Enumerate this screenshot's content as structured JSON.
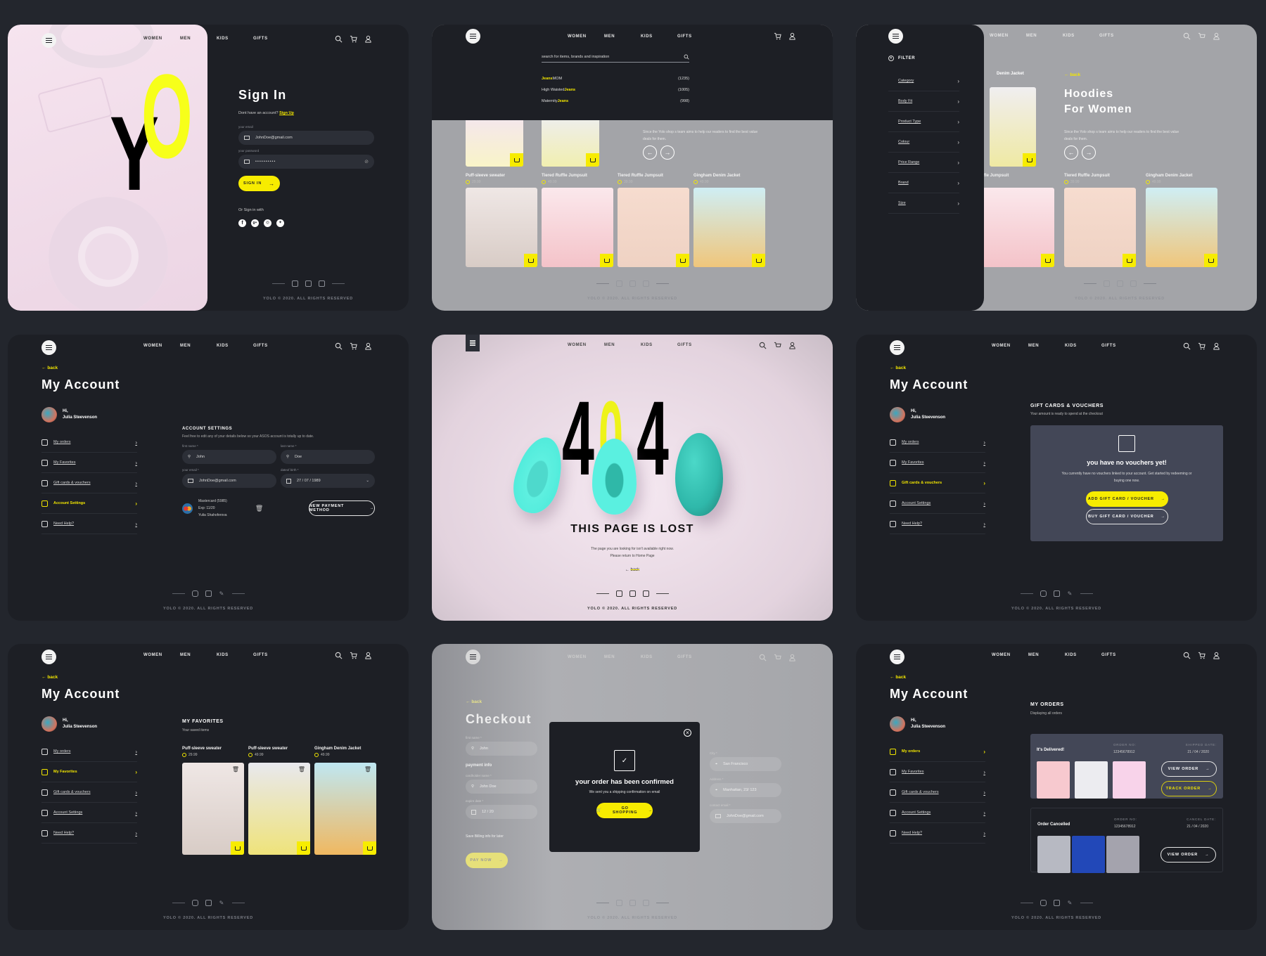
{
  "nav": {
    "links": [
      "WOMEN",
      "MEN",
      "KIDS",
      "GIFTS"
    ],
    "icons": [
      "menu-icon",
      "search-icon",
      "cart-icon",
      "user-icon"
    ]
  },
  "footer": {
    "social_icons": [
      "instagram-icon",
      "facebook-icon",
      "twitter-icon"
    ],
    "copyright": "YOLO © 2020. ALL RIGHTS RESERVED"
  },
  "colors": {
    "accent": "#f7ec00",
    "bg_dark": "#1d1f25",
    "page_bg": "#23262d",
    "card": "#434757",
    "hero_pink": "#f3dce8",
    "teal": "#3fe0d0"
  },
  "signin": {
    "logo_y": "Y",
    "logo_o": "O",
    "title": "Sign In",
    "no_account": "Dont have an account?",
    "signup_link": "Sign Up",
    "email_label": "your email",
    "email_value": "JohnDoe@gmail.com",
    "password_label": "your password",
    "password_value": "••••••••••",
    "button": "SIGN IN",
    "social_label": "Or Sign in with",
    "social": [
      "facebook-icon",
      "google-plus-icon",
      "instagram-icon",
      "twitter-icon"
    ]
  },
  "search": {
    "placeholder": "search for items, brands and inspiration",
    "suggestions": [
      {
        "prefix": "",
        "highlight": "Jeans",
        "suffix": " MOM",
        "count": "(1235)"
      },
      {
        "prefix": "High Waisted ",
        "highlight": "Jeans",
        "suffix": "",
        "count": "(1005)"
      },
      {
        "prefix": "Maternity ",
        "highlight": "Jeans",
        "suffix": "",
        "count": "(998)"
      }
    ],
    "promo_text": "Since the Yolo shop s team aims to help our readers to find the best value deals for them.",
    "products": [
      {
        "name": "Puff-sleeve sweater",
        "price": "29.99"
      },
      {
        "name": "Tiered Ruffle Jumpsuit",
        "price": "49.99"
      },
      {
        "name": "Tiered Ruffle Jumpsuit",
        "price": "39.99"
      },
      {
        "name": "Gingham Denim Jacket",
        "price": "49.99"
      }
    ]
  },
  "filter": {
    "title": "FILTER",
    "items": [
      "Category",
      "Body Fit",
      "Product Type",
      "Colour",
      "Price Range",
      "Brand",
      "Size"
    ],
    "back": "back",
    "heading_line1": "Hoodies",
    "heading_line2": "For Women",
    "promo_text": "Since the Yolo shop s team aims to help our readers to find the best value deals for them.",
    "top_label": "Denim Jacket",
    "products": [
      {
        "name": "ffle Jumpsuit",
        "price": ""
      },
      {
        "name": "Tiered Ruffle Jumpsuit",
        "price": "39.99"
      },
      {
        "name": "Gingham Denim Jacket",
        "price": "49.99"
      }
    ]
  },
  "account": {
    "back": "back",
    "title": "My Account",
    "greeting": "Hi,",
    "user_name": "Julia Steevenson",
    "menu": [
      {
        "label": "My orders",
        "icon": "orders-icon"
      },
      {
        "label": "My Favorites",
        "icon": "heart-icon"
      },
      {
        "label": "Gift cards & vouchers",
        "icon": "gift-icon"
      },
      {
        "label": "Account Settings",
        "icon": "settings-icon"
      },
      {
        "label": "Need Help?",
        "icon": "help-icon"
      }
    ]
  },
  "settings": {
    "title": "ACCOUNT SETTINGS",
    "subtitle": "Feel free to edit any of your details below so your ASOS account is totally up to date.",
    "first_name_label": "first name *",
    "first_name": "John",
    "last_name_label": "last name *",
    "last_name": "Doe",
    "email_label": "your email *",
    "email": "JohnDoe@gmail.com",
    "dob_label": "dateof birth *",
    "dob": "27 / 07 / 1989",
    "card_line1": "Mastercard (5985)",
    "card_line2": "Exp: 11/20",
    "card_line3": "Yulia Shahoferova",
    "new_payment": "NEW PAYMENT METHOD"
  },
  "notfound": {
    "digit1": "4",
    "digit2": "0",
    "digit3": "4",
    "title": "THIS PAGE IS LOST",
    "line1": "The page you are looking for isn't available right now.",
    "line2": "Please return to Home Page",
    "back": "back"
  },
  "vouchers": {
    "title": "GIFT CARDS & VOUCHERS",
    "subtitle": "Your amount is ready to spend at the checkout",
    "empty_title": "you have no vouchers yet!",
    "empty_text": "You currently have no vouchers linked to your account. Get started by redeeming or buying one now.",
    "add_button": "ADD GIFT CARD / VOUCHER",
    "buy_button": "BUY GIFT CARD / VOUCHER"
  },
  "favorites": {
    "title": "MY FAVORITES",
    "subtitle": "Your saved items",
    "items": [
      {
        "name": "Puff-sleeve sweater",
        "price": "29.99"
      },
      {
        "name": "Puff-sleeve sweater",
        "price": "49.99"
      },
      {
        "name": "Gingham Denim Jacket",
        "price": "49.99"
      }
    ]
  },
  "checkout": {
    "back": "back",
    "title": "Checkout",
    "first_name_label": "first name *",
    "first_name": "John",
    "payment_info": "payment info",
    "cardholder_label": "cardholder name *",
    "cardholder": "John Doe",
    "expire_label": "expire date *",
    "expire": "12 / 20",
    "save_billing": "Save Billing info for later",
    "pay_button": "PAY NOW",
    "city_label": "City *",
    "city": "San Francisco",
    "address_label": "Address *",
    "address": "Manhattan, 23/ 123",
    "contact_label": "contact email *",
    "contact_email": "JohnDoe@gmail.com",
    "modal_title": "your order has been confirmed",
    "modal_text": "We sent you a shipping confirmation on email",
    "modal_button": "GO SHOPPING"
  },
  "orders": {
    "title": "MY ORDERS",
    "subtitle": "Displaying all orders",
    "list": [
      {
        "status": "It's Delivered!",
        "order_no_label": "ORDER NO:",
        "order_no": "12345678912",
        "date_label": "SHIPPED DATE:",
        "date": "21 / 04 / 2020",
        "buttons": [
          "VIEW ORDER",
          "TRACK ORDER"
        ]
      },
      {
        "status": "Order Cancelled",
        "order_no_label": "ORDER NO:",
        "order_no": "12345678912",
        "date_label": "CANCEL DATE:",
        "date": "21 / 04 / 2020",
        "buttons": [
          "VIEW ORDER"
        ]
      }
    ]
  }
}
